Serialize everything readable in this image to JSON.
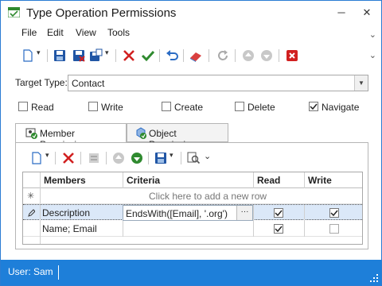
{
  "window": {
    "title": "Type Operation Permissions",
    "minimize": "─",
    "close": "✕"
  },
  "menu": {
    "items": [
      "File",
      "Edit",
      "View",
      "Tools"
    ]
  },
  "form": {
    "target_type_label": "Target Type:",
    "target_type_value": "Contact",
    "checkboxes": [
      {
        "label": "Read",
        "checked": false
      },
      {
        "label": "Write",
        "checked": false
      },
      {
        "label": "Create",
        "checked": false
      },
      {
        "label": "Delete",
        "checked": false
      },
      {
        "label": "Navigate",
        "checked": true
      }
    ]
  },
  "tabs": [
    {
      "label": "Member Permissions",
      "active": true
    },
    {
      "label": "Object Permissions",
      "active": false
    }
  ],
  "grid": {
    "columns": [
      "Members",
      "Criteria",
      "Read",
      "Write"
    ],
    "new_row_prompt": "Click here to add a new row",
    "rows": [
      {
        "members": "Description",
        "criteria": "EndsWith([Email], '.org')",
        "read": true,
        "write": true,
        "editing": true
      },
      {
        "members": "Name; Email",
        "criteria": "",
        "read": true,
        "write": false,
        "editing": false
      }
    ],
    "ellipsis": "···"
  },
  "status": {
    "user": "User: Sam"
  },
  "colors": {
    "accent": "#1e7fd9",
    "selected_row": "#dbe8f8",
    "delete_red": "#d12020",
    "save_blue": "#2156a5"
  }
}
